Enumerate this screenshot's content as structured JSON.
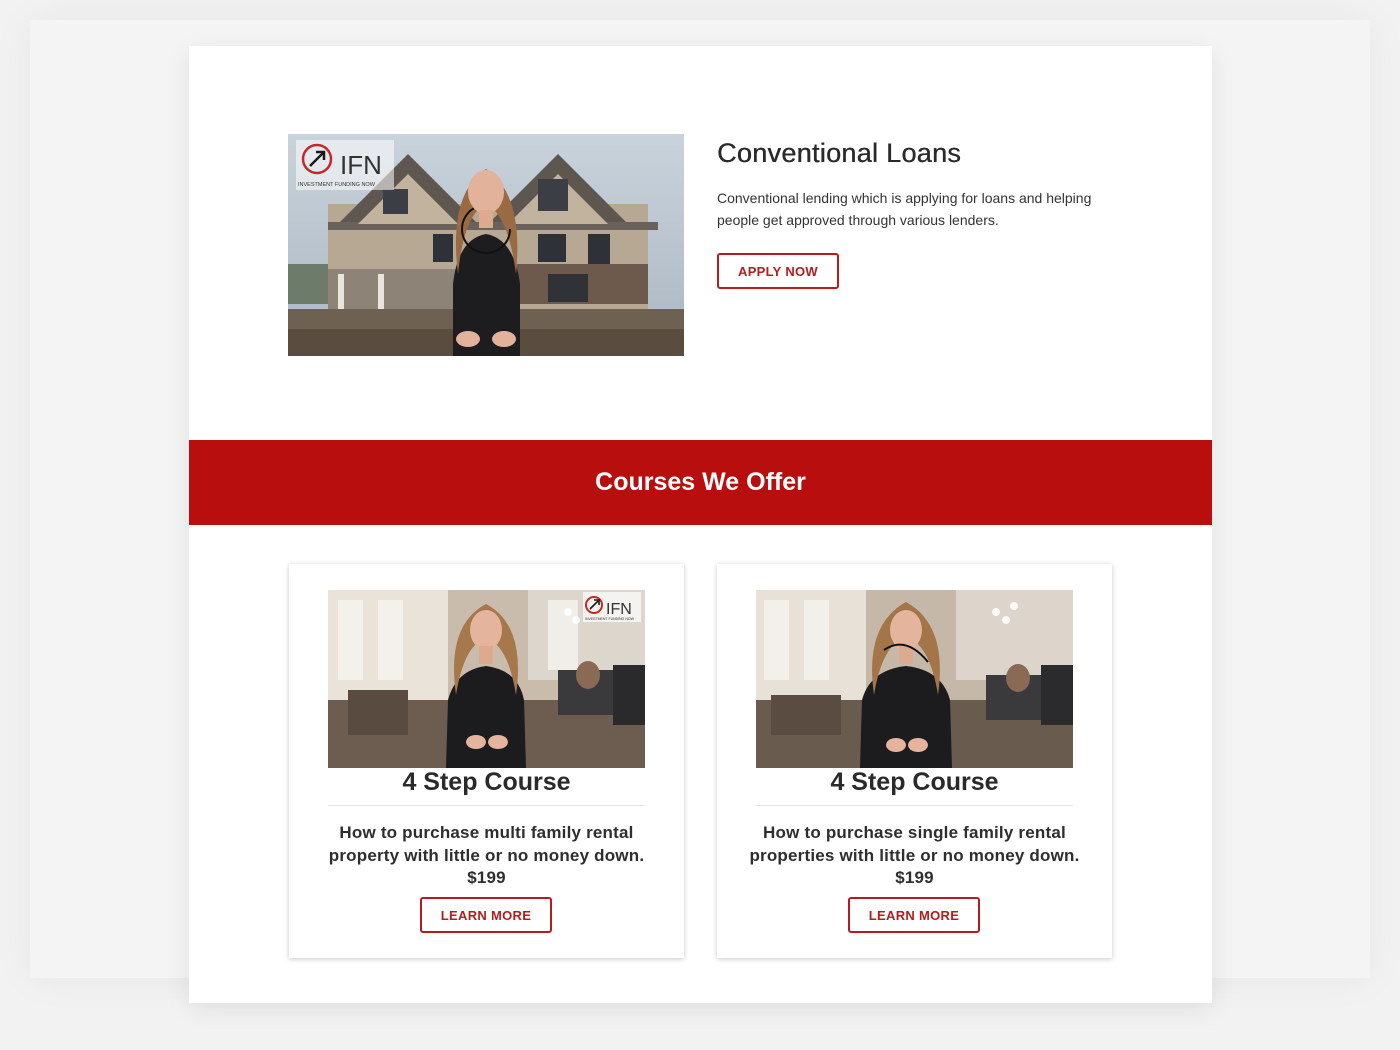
{
  "hero": {
    "title": "Conventional Loans",
    "description": "Conventional lending which is applying for loans and helping people get approved through various lenders.",
    "button_label": "APPLY NOW",
    "video_logo_text": "IFN",
    "video_logo_subtext": "INVESTMENT FUNDING NOW"
  },
  "banner": {
    "title": "Courses We Offer"
  },
  "courses": [
    {
      "title": "4 Step Course",
      "description": "How to purchase multi family rental property with little or no money down. $199",
      "button_label": "LEARN MORE",
      "video_logo_text": "IFN",
      "video_logo_subtext": "INVESTMENT FUNDING NOW"
    },
    {
      "title": "4 Step Course",
      "description": "How to purchase single family rental properties with little or no money down. $199",
      "button_label": "LEARN MORE"
    }
  ],
  "colors": {
    "accent": "#b90e0e",
    "button_border": "#b71c1c",
    "page_background": "#f2f2f2"
  }
}
